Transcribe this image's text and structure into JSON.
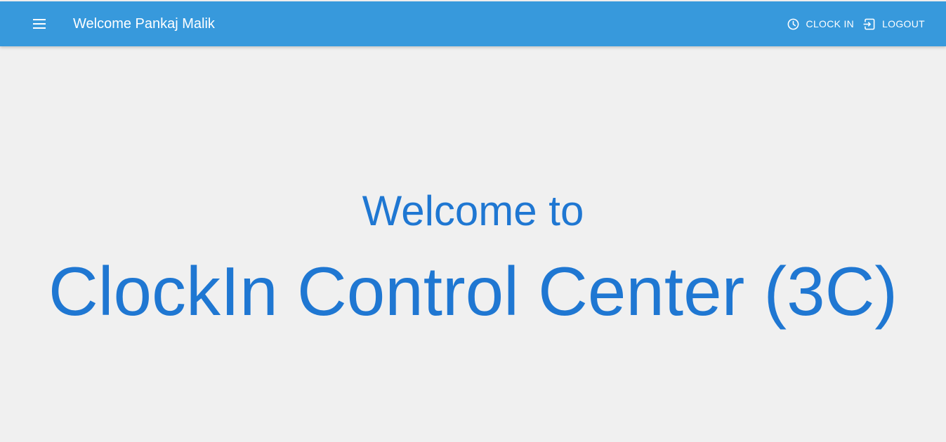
{
  "colors": {
    "appbar_background": "#3799dc",
    "appbar_text": "#ffffff",
    "page_background": "#f0f0f0",
    "hero_text": "#1f77d2"
  },
  "appbar": {
    "menu_icon": "hamburger-menu-icon",
    "title": "Welcome Pankaj Malik",
    "actions": [
      {
        "icon": "clock-icon",
        "label": "CLOCK IN"
      },
      {
        "icon": "logout-icon",
        "label": "LOGOUT"
      }
    ]
  },
  "hero": {
    "line1": "Welcome to",
    "line2": "ClockIn Control Center (3C)"
  }
}
